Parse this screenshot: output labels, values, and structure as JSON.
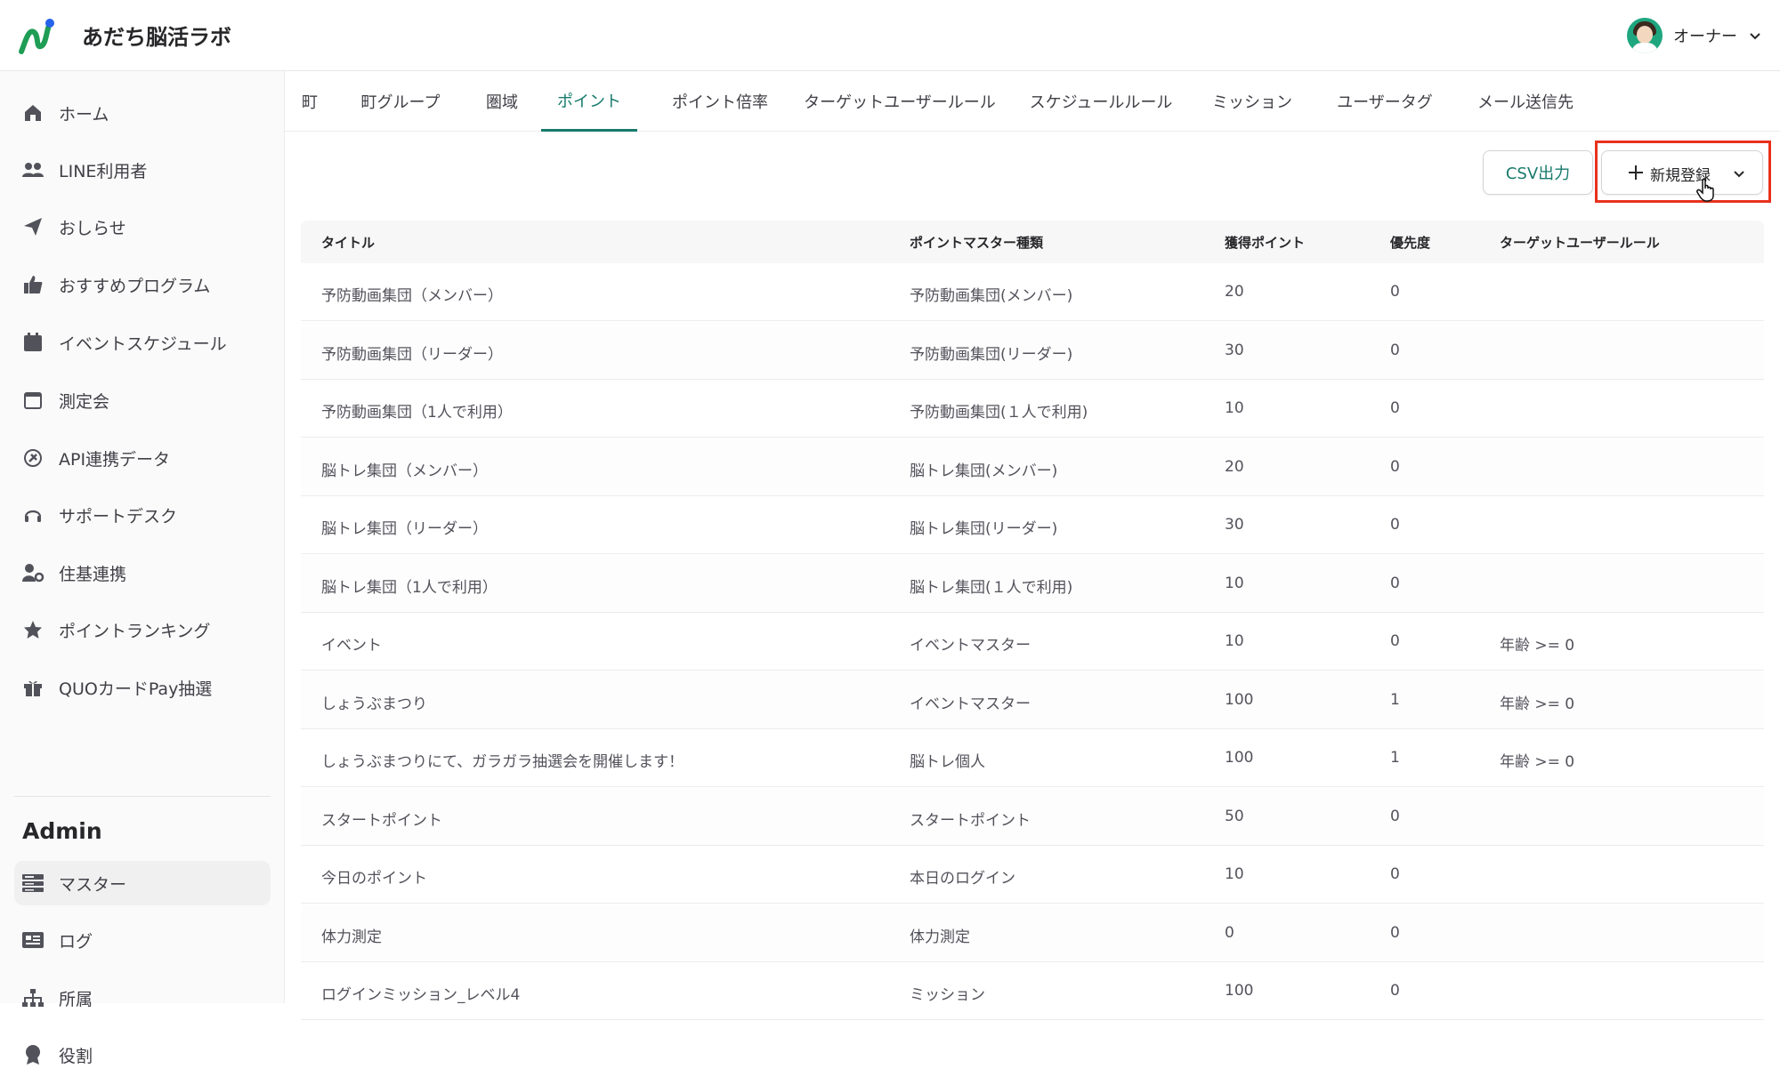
{
  "app": {
    "brand": "あだち脳活ラボ",
    "accent": "#177a6c",
    "logo_colors": [
      "#1f9d55",
      "#2563eb"
    ]
  },
  "user": {
    "name": "オーナー",
    "icon": "chevron-down-icon"
  },
  "sidebar": {
    "items": [
      {
        "label": "ホーム",
        "icon": "home-icon"
      },
      {
        "label": "LINE利用者",
        "icon": "users-icon"
      },
      {
        "label": "おしらせ",
        "icon": "paper-plane-icon"
      },
      {
        "label": "おすすめプログラム",
        "icon": "thumbs-up-icon"
      },
      {
        "label": "イベントスケジュール",
        "icon": "calendar-icon"
      },
      {
        "label": "測定会",
        "icon": "calendar-outline-icon"
      },
      {
        "label": "API連携データ",
        "icon": "plug-icon"
      },
      {
        "label": "サポートデスク",
        "icon": "headset-icon"
      },
      {
        "label": "住基連携",
        "icon": "user-gear-icon"
      },
      {
        "label": "ポイントランキング",
        "icon": "star-icon"
      },
      {
        "label": "QUOカードPay抽選",
        "icon": "gift-icon"
      }
    ],
    "admin_heading": "Admin",
    "admin_items": [
      {
        "label": "マスター",
        "icon": "database-icon",
        "active": true
      },
      {
        "label": "ログ",
        "icon": "log-icon"
      },
      {
        "label": "所属",
        "icon": "sitemap-icon"
      },
      {
        "label": "役割",
        "icon": "badge-icon"
      }
    ]
  },
  "tabs": [
    {
      "label": "町"
    },
    {
      "label": "町グループ"
    },
    {
      "label": "圏域"
    },
    {
      "label": "ポイント",
      "active": true
    },
    {
      "label": "ポイント倍率"
    },
    {
      "label": "ターゲットユーザールール"
    },
    {
      "label": "スケジュールルール"
    },
    {
      "label": "ミッション"
    },
    {
      "label": "ユーザータグ"
    },
    {
      "label": "メール送信先"
    }
  ],
  "actions": {
    "csv_label": "CSV出力",
    "new_label": "新規登録",
    "highlight_color": "#e8311e"
  },
  "table": {
    "columns": [
      "タイトル",
      "ポイントマスター種類",
      "獲得ポイント",
      "優先度",
      "ターゲットユーザールール"
    ],
    "rows": [
      [
        "予防動画集団（メンバー）",
        "予防動画集団(メンバー)",
        "20",
        "0",
        ""
      ],
      [
        "予防動画集団（リーダー）",
        "予防動画集団(リーダー)",
        "30",
        "0",
        ""
      ],
      [
        "予防動画集団（1人で利用）",
        "予防動画集団(１人で利用)",
        "10",
        "0",
        ""
      ],
      [
        "脳トレ集団（メンバー）",
        "脳トレ集団(メンバー)",
        "20",
        "0",
        ""
      ],
      [
        "脳トレ集団（リーダー）",
        "脳トレ集団(リーダー)",
        "30",
        "0",
        ""
      ],
      [
        "脳トレ集団（1人で利用）",
        "脳トレ集団(１人で利用)",
        "10",
        "0",
        ""
      ],
      [
        "イベント",
        "イベントマスター",
        "10",
        "0",
        "年齢 >= 0"
      ],
      [
        "しょうぶまつり",
        "イベントマスター",
        "100",
        "1",
        "年齢 >= 0"
      ],
      [
        "しょうぶまつりにて、ガラガラ抽選会を開催します！",
        "脳トレ個人",
        "100",
        "1",
        "年齢 >= 0"
      ],
      [
        "スタートポイント",
        "スタートポイント",
        "50",
        "0",
        ""
      ],
      [
        "今日のポイント",
        "本日のログイン",
        "10",
        "0",
        ""
      ],
      [
        "体力測定",
        "体力測定",
        "0",
        "0",
        ""
      ],
      [
        "ログインミッション_レベル4",
        "ミッション",
        "100",
        "0",
        ""
      ]
    ]
  }
}
